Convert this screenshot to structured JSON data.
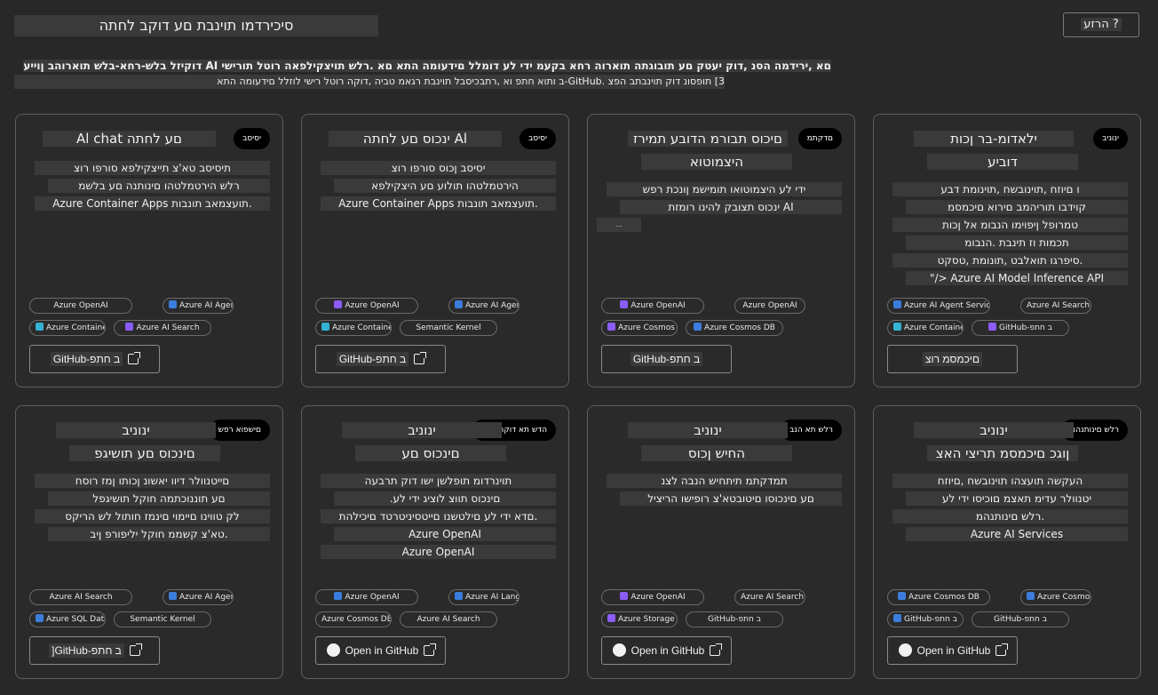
{
  "page": {
    "title": "סיכירדמו תוינבת םע דוקב לחתה",
    "help_label": "הרזע ?",
    "intro_line_1": "םא ,ירידמה הסנ ,דוק יעטק םע תובוגתה תוארוה רחא בקעמ ידי לע דומלל םידעומה התא םא .רלש תויצקילפאה רוטל תורישי AI דוקיזל בלש-רחא-בלש תוארוהב ןוייע",
    "intro_line_2": "3] תופסונ דוק תוינבתב הפצ .GitHub-ב ותוא חתפ וא ,רתבכיסבל תוינבת רגאמ טביה ,דוקה רוטל רישי לוזלל םידעומה התא"
  },
  "colors": {
    "background": "#282828",
    "card_bg": "#2a2a2a",
    "card_border": "#5e5e5e",
    "highlight": "#3a3a3a",
    "badge_bg": "#000000",
    "chip_icon_blue": "#3b7ddd",
    "chip_icon_purple": "#8b5cf6",
    "chip_icon_cyan": "#34b3d4"
  },
  "cards": [
    {
      "badge": "יסיסב",
      "title": [
        "Al chat םע לחתה"
      ],
      "desc": [
        "תיסיסב טא'צ תייצקילפא סורפו רוצ",
        "רלש הירטמלטהו םינותנה םע בלשמ",
        "Azure Container Apps תועצמאב תונבות."
      ],
      "chips": [
        {
          "label": "Azure OpenAI",
          "icon": ""
        },
        {
          "label": "Azure AI Agent Service",
          "icon": "blue"
        },
        {
          "label": "Azure Container Apps",
          "icon": "cyan"
        },
        {
          "label": "Azure AI Search",
          "icon": "purple"
        }
      ],
      "button": "GitHub-ב חתפ",
      "button_icon": "external-link-icon"
    },
    {
      "badge": "יסיסב",
      "title": [
        "ינכוס םע לחתה Al"
      ],
      "desc": [
        "יסיסב ןכוס סורפו רוצ",
        "הירטמלטהו תולוע םע היצקילפא",
        "Azure Container Apps תועצמאב תונבות."
      ],
      "chips": [
        {
          "label": "Azure OpenAI",
          "icon": "purple"
        },
        {
          "label": "Azure AI Agent Service",
          "icon": "blue"
        },
        {
          "label": "Azure Container Apps",
          "icon": "cyan"
        },
        {
          "label": "Semantic Kernel",
          "icon": ""
        }
      ],
      "button": "GitHub-ב חתפ",
      "button_icon": "external-link-icon"
    },
    {
      "badge": "םדקתמ",
      "title": [
        "םיכוס תבורמ הדובע תמירז",
        "היצמוטוא"
      ],
      "desc": [
        "ידי לע היצמוטואו תומישמ ןונכת רפש",
        "ינכוס תצובק להינו רומזת AI",
        "..."
      ],
      "chips": [
        {
          "label": "Azure OpenAI",
          "icon": "purple"
        },
        {
          "label": "Azure OpenAI",
          "icon": ""
        },
        {
          "label": "Azure Cosmos DB",
          "icon": "purple"
        },
        {
          "label": "Azure Cosmos DB",
          "icon": "blue"
        }
      ],
      "button": "GitHub-ב חתפ",
      "button_icon": ""
    },
    {
      "badge": "ינוניב",
      "title": [
        "ילאדומ-בר ןכות",
        "דוביע"
      ],
      "desc": [
        "ו םיוזח ,תוינובשח ,תוינומת דבע",
        "קוידבו תוריהמב םירוא םיכמסמ",
        "טמרופל ןיפוימו הנבומ אל ןכות",
        "תכמות וז תינבת .הנבומ",
        "סיפרגו תואלבט ,תונומת ,טסקט.",
        "\"/> Azure AI Model Inference API"
      ],
      "chips": [
        {
          "label": "Azure AI Agent Service",
          "icon": "blue"
        },
        {
          "label": "Azure AI Search",
          "icon": ""
        },
        {
          "label": "Azure Container Apps",
          "icon": "cyan"
        },
        {
          "label": "GitHub-ב חתפ",
          "icon": "purple"
        }
      ],
      "button": "םיכמסמ רוצ",
      "button_icon": ""
    },
    {
      "badge": "םישפוא רפש",
      "title": [
        "ינוניב",
        "םינכוס םע תושיגפ"
      ],
      "desc": [
        "םייטנוולר דיוו יאשונ ןכותו ןמז רוסח",
        "םע תוננוכתמה חוקל תושיגפל",
        "לק טווינו םיימוי םינמז חותול לש הריקס",
        "טא'צ קשממ חוקל יליפורפ ןיב."
      ],
      "chips": [
        {
          "label": "Azure AI Search",
          "icon": ""
        },
        {
          "label": "Azure AI Agent Service",
          "icon": "blue"
        },
        {
          "label": "Azure SQL Database",
          "icon": "blue"
        },
        {
          "label": "Semantic Kernel",
          "icon": ""
        }
      ],
      "button": "]GitHub-ב חתפ",
      "button_icon": "external-link-icon"
    },
    {
      "badge": "הדש תא דוקה רלש",
      "title": [
        "ינוניב",
        "םינכוס םע"
      ],
      "desc": [
        "תוינרדומ תופלשן ישו דוק תרבעה",
        ".םינכוס תווצ לוציג ידי לע",
        "םדא ידי לע םילטשנו םייטסיניטרטד םיכילהת.",
        "Azure OpenAI",
        "Azure OpenAI"
      ],
      "chips": [
        {
          "label": "Azure OpenAI",
          "icon": "blue"
        },
        {
          "label": "Azure AI Language",
          "icon": "blue"
        },
        {
          "label": "Azure Cosmos DB",
          "icon": ""
        },
        {
          "label": "Azure AI Search",
          "icon": ""
        }
      ],
      "button": "Open in GitHub",
      "button_icon": "external-link-icon"
    },
    {
      "badge": "רלש תא הנב",
      "title": [
        "ינוניב",
        "החיש ןכוס"
      ],
      "desc": [
        "תמדקתמ תיתחיש הנבה לצנ",
        "םע םינכוסו םיטובטא'צ רופישו הריציל"
      ],
      "chips": [
        {
          "label": "Azure OpenAI",
          "icon": "purple"
        },
        {
          "label": "Azure AI Search",
          "icon": ""
        },
        {
          "label": "Azure Storage Account",
          "icon": "purple"
        },
        {
          "label": "GitHub-ב חתפ",
          "icon": ""
        }
      ],
      "button": "Open in GitHub",
      "button_icon": "external-link-icon"
    },
    {
      "badge": "רלש םינותנהמ",
      "title": [
        "ינוניב",
        "ןוגכ םיכמסמ תריצי האצ"
      ],
      "desc": [
        "העקשה תועצהו תוינובשח ,םיוזח",
        "יטנוולר עדימ תאצמ םוכיסו ידי לע",
        "רלש םינותנהמ.",
        "Azure AI Services"
      ],
      "chips": [
        {
          "label": "Azure Cosmos DB",
          "icon": "blue"
        },
        {
          "label": "Azure Cosmos DB",
          "icon": "blue"
        },
        {
          "label": "GitHub-ב חתפ",
          "icon": "blue"
        },
        {
          "label": "GitHub-ב חתפ",
          "icon": ""
        }
      ],
      "button": "Open in GitHub",
      "button_icon": "external-link-icon"
    }
  ]
}
